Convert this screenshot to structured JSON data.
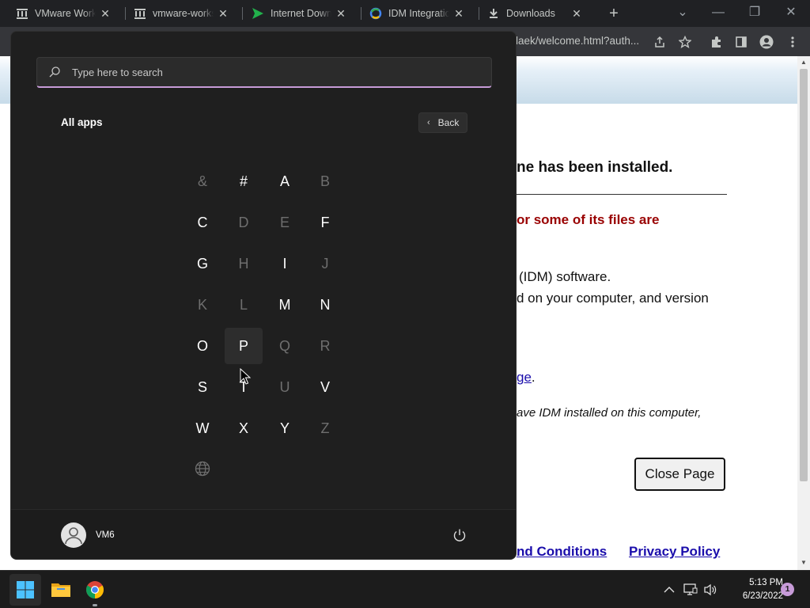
{
  "browser": {
    "tabs": [
      {
        "title": "VMware Workst",
        "icon": "vmware-museum-icon"
      },
      {
        "title": "vmware-workst",
        "icon": "vmware-museum-icon"
      },
      {
        "title": "Internet Downlo",
        "icon": "idm-arrow-icon"
      },
      {
        "title": "IDM Integration",
        "icon": "idm-integration-icon"
      },
      {
        "title": "Downloads",
        "icon": "download-icon"
      }
    ],
    "url": "laek/welcome.html?auth..."
  },
  "webpage": {
    "heading": "ne has been installed.",
    "warning": "or some of its files are",
    "line1": "(IDM) software.",
    "line2": "d on your computer, and version",
    "link": "ge",
    "link_after": ".",
    "note": "ave IDM installed on this computer,",
    "close_button": "Close Page",
    "footer_link1": "nd Conditions",
    "footer_link2": "Privacy Policy"
  },
  "start_menu": {
    "search_placeholder": "Type here to search",
    "all_apps_label": "All apps",
    "back_label": "Back",
    "letters": [
      {
        "char": "&",
        "enabled": false
      },
      {
        "char": "#",
        "enabled": true
      },
      {
        "char": "A",
        "enabled": true
      },
      {
        "char": "B",
        "enabled": false
      },
      {
        "char": "C",
        "enabled": true
      },
      {
        "char": "D",
        "enabled": false
      },
      {
        "char": "E",
        "enabled": false
      },
      {
        "char": "F",
        "enabled": true
      },
      {
        "char": "G",
        "enabled": true
      },
      {
        "char": "H",
        "enabled": false
      },
      {
        "char": "I",
        "enabled": true
      },
      {
        "char": "J",
        "enabled": false
      },
      {
        "char": "K",
        "enabled": false
      },
      {
        "char": "L",
        "enabled": false
      },
      {
        "char": "M",
        "enabled": true
      },
      {
        "char": "N",
        "enabled": true
      },
      {
        "char": "O",
        "enabled": true
      },
      {
        "char": "P",
        "enabled": true,
        "hovered": true
      },
      {
        "char": "Q",
        "enabled": false
      },
      {
        "char": "R",
        "enabled": false
      },
      {
        "char": "S",
        "enabled": true
      },
      {
        "char": "T",
        "enabled": true
      },
      {
        "char": "U",
        "enabled": false
      },
      {
        "char": "V",
        "enabled": true
      },
      {
        "char": "W",
        "enabled": true
      },
      {
        "char": "X",
        "enabled": true
      },
      {
        "char": "Y",
        "enabled": true
      },
      {
        "char": "Z",
        "enabled": false
      }
    ],
    "globe_icon": "globe-icon",
    "user_name": "VM6"
  },
  "taskbar": {
    "apps": [
      "windows-start-icon",
      "file-explorer-icon",
      "chrome-icon"
    ],
    "time": "5:13 PM",
    "date": "6/23/2022",
    "notification_count": "1"
  },
  "colors": {
    "menu_bg": "#1f1f1f",
    "accent": "#c79bd8",
    "warning_red": "#990000",
    "link_blue": "#1a0dab"
  }
}
